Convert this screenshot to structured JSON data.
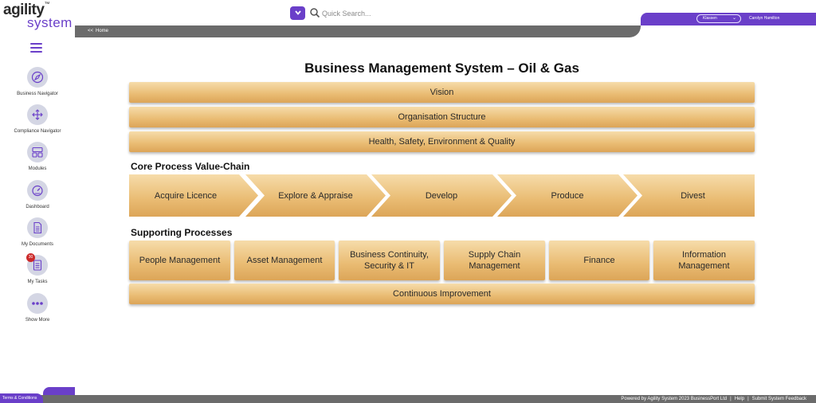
{
  "brand": {
    "logo_line1": "agility",
    "logo_tm": "™",
    "logo_line2": "system",
    "accent_color": "#6a3fc9",
    "band_color": "#e9bb72"
  },
  "search": {
    "placeholder": "Quick Search...",
    "dropdown_icon": "chevron-down-icon",
    "search_icon": "magnifier-icon"
  },
  "user": {
    "location": "Klassen",
    "name": "Carolyn Hamilton"
  },
  "breadcrumb": {
    "arrows": "<<",
    "label": "Home"
  },
  "sidebar": {
    "menu_icon": "hamburger-icon",
    "items": [
      {
        "label": "Business Navigator",
        "icon": "compass-icon"
      },
      {
        "label": "Compliance Navigator",
        "icon": "move-arrows-icon"
      },
      {
        "label": "Modules",
        "icon": "modules-grid-icon"
      },
      {
        "label": "Dashboard",
        "icon": "speedometer-icon"
      },
      {
        "label": "My Documents",
        "icon": "document-icon"
      },
      {
        "label": "My Tasks",
        "icon": "tasks-icon",
        "badge": "30"
      },
      {
        "label": "Show More",
        "icon": "more-dots-icon"
      }
    ]
  },
  "main": {
    "title": "Business Management System – Oil & Gas",
    "bands_top": [
      "Vision",
      "Organisation Structure",
      "Health, Safety, Environment & Quality"
    ],
    "core_heading": "Core Process Value-Chain",
    "core_steps": [
      "Acquire Licence",
      "Explore & Appraise",
      "Develop",
      "Produce",
      "Divest"
    ],
    "support_heading": "Supporting Processes",
    "support_items": [
      "People Management",
      "Asset Management",
      "Business Continuity,\nSecurity & IT",
      "Supply Chain\nManagement",
      "Finance",
      "Information\nManagement"
    ],
    "bottom_band": "Continuous Improvement"
  },
  "footer": {
    "terms": "Terms & Conditions",
    "powered_by": "Powered by Agility System 2023 BusinessPort Ltd",
    "help": "Help",
    "feedback": "Submit System Feedback"
  }
}
